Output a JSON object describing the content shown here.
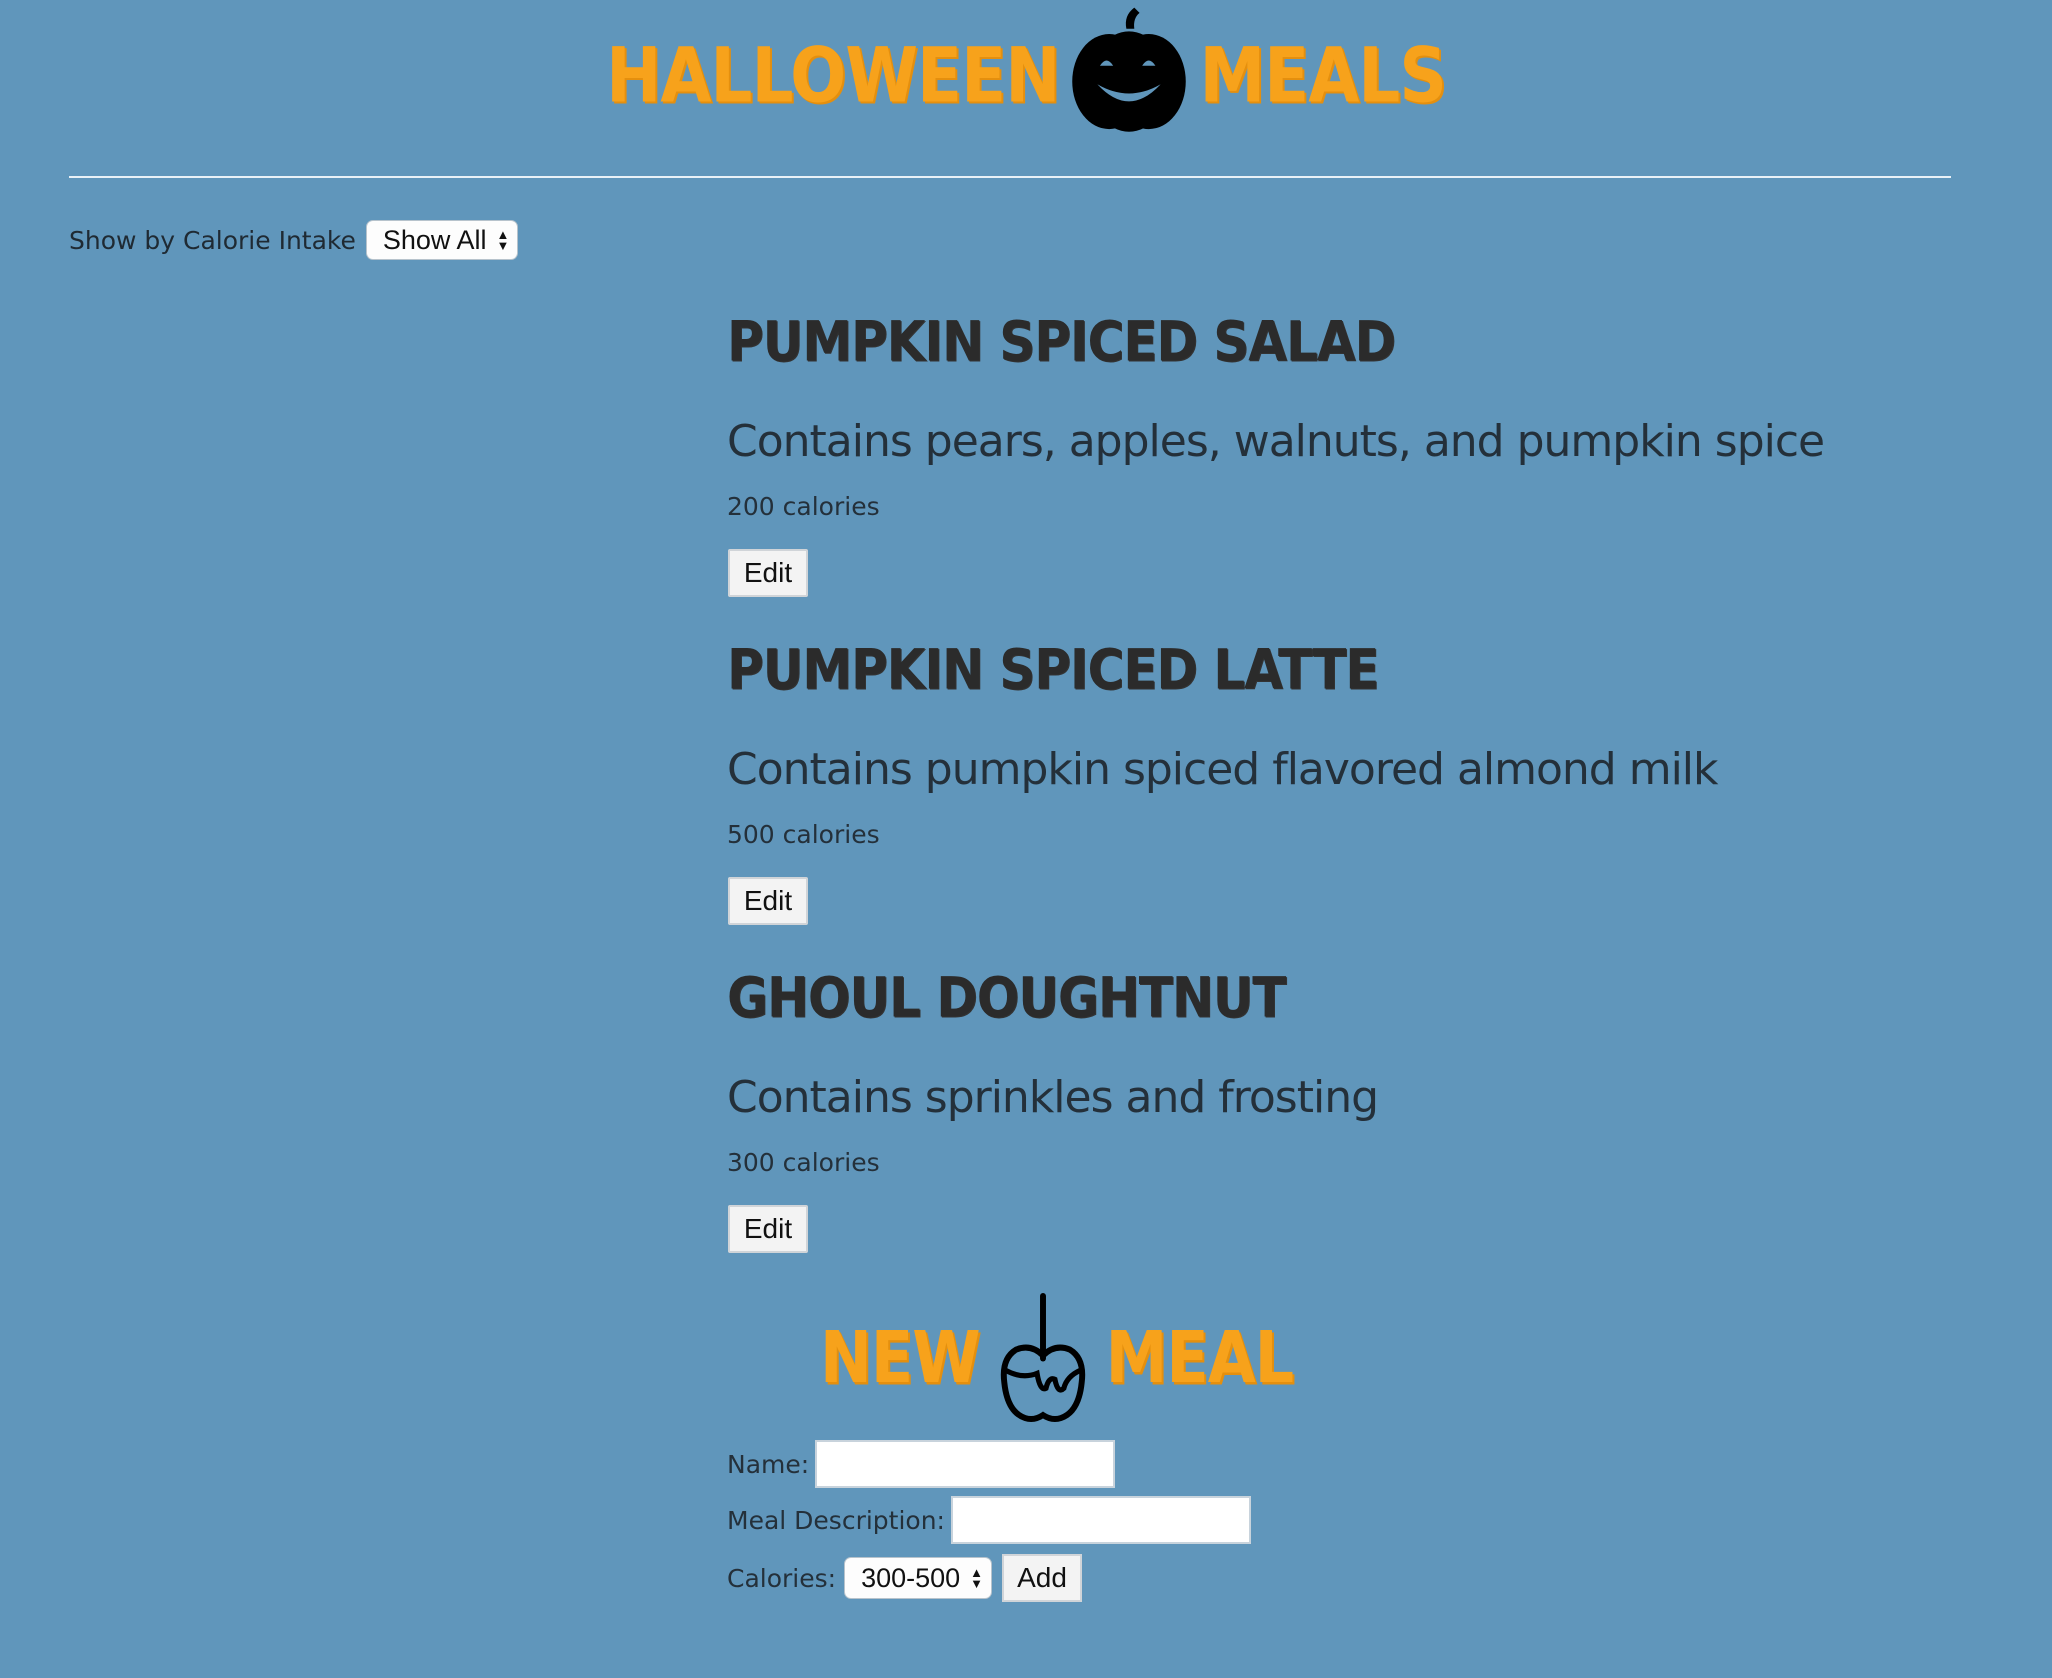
{
  "header": {
    "word_left": "HALLOWEEN",
    "word_right": "MEALS",
    "icon": "pumpkin-icon"
  },
  "filter": {
    "label": "Show by Calorie Intake",
    "selected": "Show All"
  },
  "meals": [
    {
      "name": "PUMPKIN SPICED SALAD",
      "description": "Contains pears, apples, walnuts, and pumpkin spice",
      "calories": "200 calories",
      "edit_label": "Edit"
    },
    {
      "name": "PUMPKIN SPICED LATTE",
      "description": "Contains pumpkin spiced flavored almond milk",
      "calories": "500 calories",
      "edit_label": "Edit"
    },
    {
      "name": "GHOUL DOUGHTNUT",
      "description": "Contains sprinkles and frosting",
      "calories": "300 calories",
      "edit_label": "Edit"
    }
  ],
  "new_meal": {
    "word_left": "NEW",
    "word_right": "MEAL",
    "icon": "candy-apple-icon",
    "name_label": "Name:",
    "name_value": "",
    "description_label": "Meal Description:",
    "description_value": "",
    "calories_label": "Calories:",
    "calories_selected": "300-500",
    "add_label": "Add"
  },
  "colors": {
    "background": "#6096bb",
    "accent": "#f7a21b",
    "text": "#24303a"
  }
}
